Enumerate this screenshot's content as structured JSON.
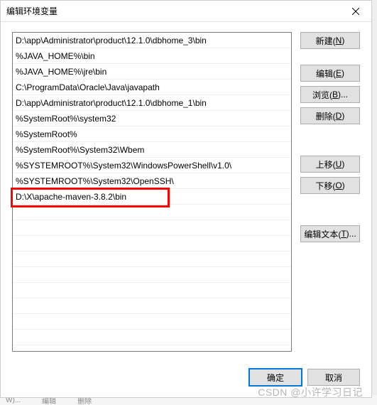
{
  "dialog": {
    "title": "编辑环境变量"
  },
  "list": {
    "items": [
      "D:\\app\\Administrator\\product\\12.1.0\\dbhome_3\\bin",
      "%JAVA_HOME%\\bin",
      "%JAVA_HOME%\\jre\\bin",
      "C:\\ProgramData\\Oracle\\Java\\javapath",
      "D:\\app\\Administrator\\product\\12.1.0\\dbhome_1\\bin",
      "%SystemRoot%\\system32",
      "%SystemRoot%",
      "%SystemRoot%\\System32\\Wbem",
      "%SYSTEMROOT%\\System32\\WindowsPowerShell\\v1.0\\",
      "%SYSTEMROOT%\\System32\\OpenSSH\\",
      "D:\\X\\apache-maven-3.8.2\\bin"
    ]
  },
  "buttons": {
    "new": {
      "label": "新建(",
      "key": "N",
      "suffix": ")"
    },
    "edit": {
      "label": "编辑(",
      "key": "E",
      "suffix": ")"
    },
    "browse": {
      "label": "浏览(",
      "key": "B",
      "suffix": ")..."
    },
    "delete": {
      "label": "删除(",
      "key": "D",
      "suffix": ")"
    },
    "moveup": {
      "label": "上移(",
      "key": "U",
      "suffix": ")"
    },
    "movedown": {
      "label": "下移(",
      "key": "O",
      "suffix": ")"
    },
    "edittext": {
      "label": "编辑文本(",
      "key": "T",
      "suffix": ")..."
    },
    "ok": "确定",
    "cancel": "取消"
  },
  "watermark": "CSDN @小许学习日记",
  "bg": {
    "w": "W)...",
    "edit": "编辑",
    "del": "删除"
  },
  "highlight_index": 10
}
